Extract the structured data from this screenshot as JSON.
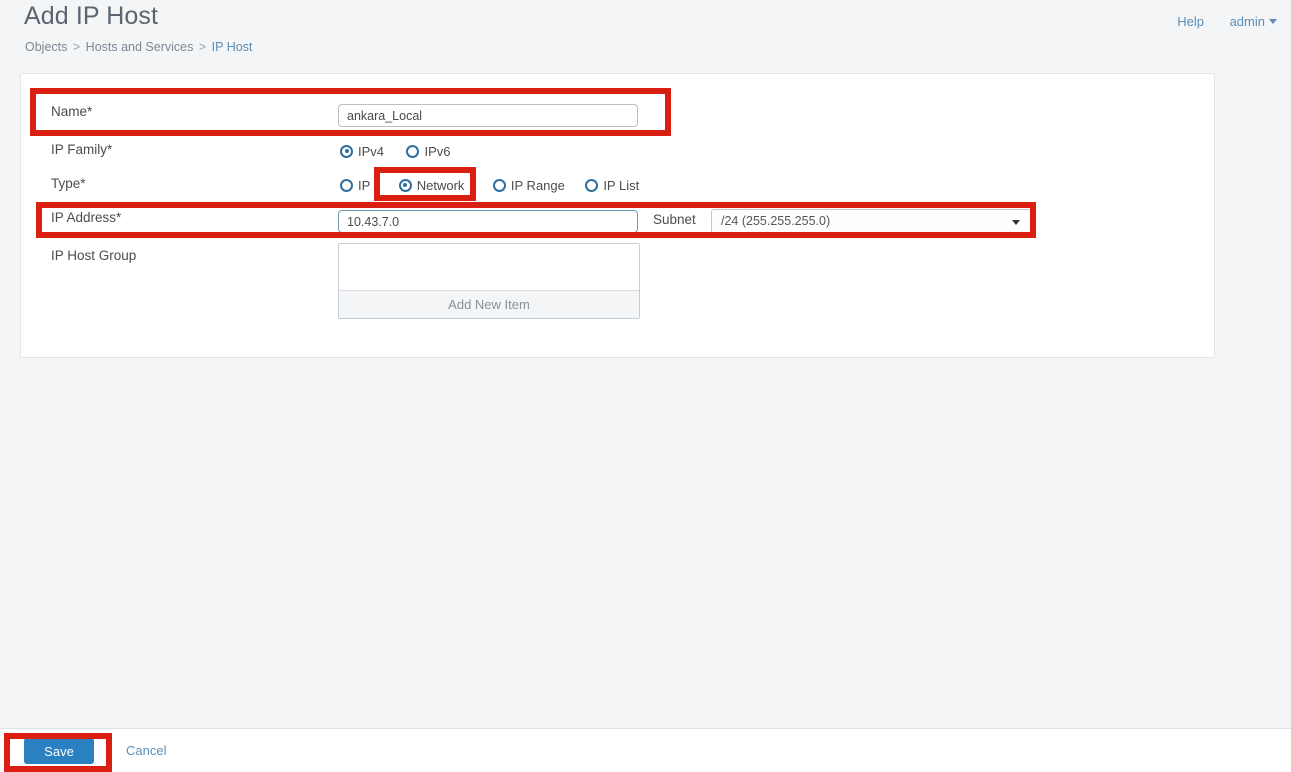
{
  "header": {
    "title": "Add IP Host",
    "breadcrumb": {
      "items": [
        "Objects",
        "Hosts and Services",
        "IP Host"
      ],
      "separator": ">"
    },
    "links": {
      "help": "Help",
      "admin": "admin",
      "admin_caret_icon": "chevron-down-icon"
    }
  },
  "form": {
    "name": {
      "label": "Name",
      "required_marker": "*",
      "value": "ankara_Local",
      "placeholder": ""
    },
    "ip_family": {
      "label": "IP Family",
      "required_marker": "*",
      "options": [
        "IPv4",
        "IPv6"
      ],
      "selected": "IPv4"
    },
    "type": {
      "label": "Type",
      "required_marker": "*",
      "options": [
        "IP",
        "Network",
        "IP Range",
        "IP List"
      ],
      "selected": "Network"
    },
    "ip_address": {
      "label": "IP Address",
      "required_marker": "*",
      "value": "10.43.7.0",
      "placeholder": ""
    },
    "subnet": {
      "label": "Subnet",
      "selected": "/24 (255.255.255.0)",
      "arrow_icon": "chevron-down-icon"
    },
    "ip_host_group": {
      "label": "IP Host Group",
      "add_new_item_label": "Add New Item",
      "items": []
    }
  },
  "footer": {
    "save_label": "Save",
    "cancel_label": "Cancel"
  },
  "annotations": {
    "color": "#d91f11",
    "boxes": [
      "name-row",
      "network-option",
      "ip-address-row",
      "save-button"
    ]
  },
  "colors": {
    "page_background": "#f4f5f7",
    "card_background": "#ffffff",
    "accent_blue": "#2a80c0",
    "link_blue": "#5b8fb9",
    "annotation_red": "#d91f11"
  }
}
